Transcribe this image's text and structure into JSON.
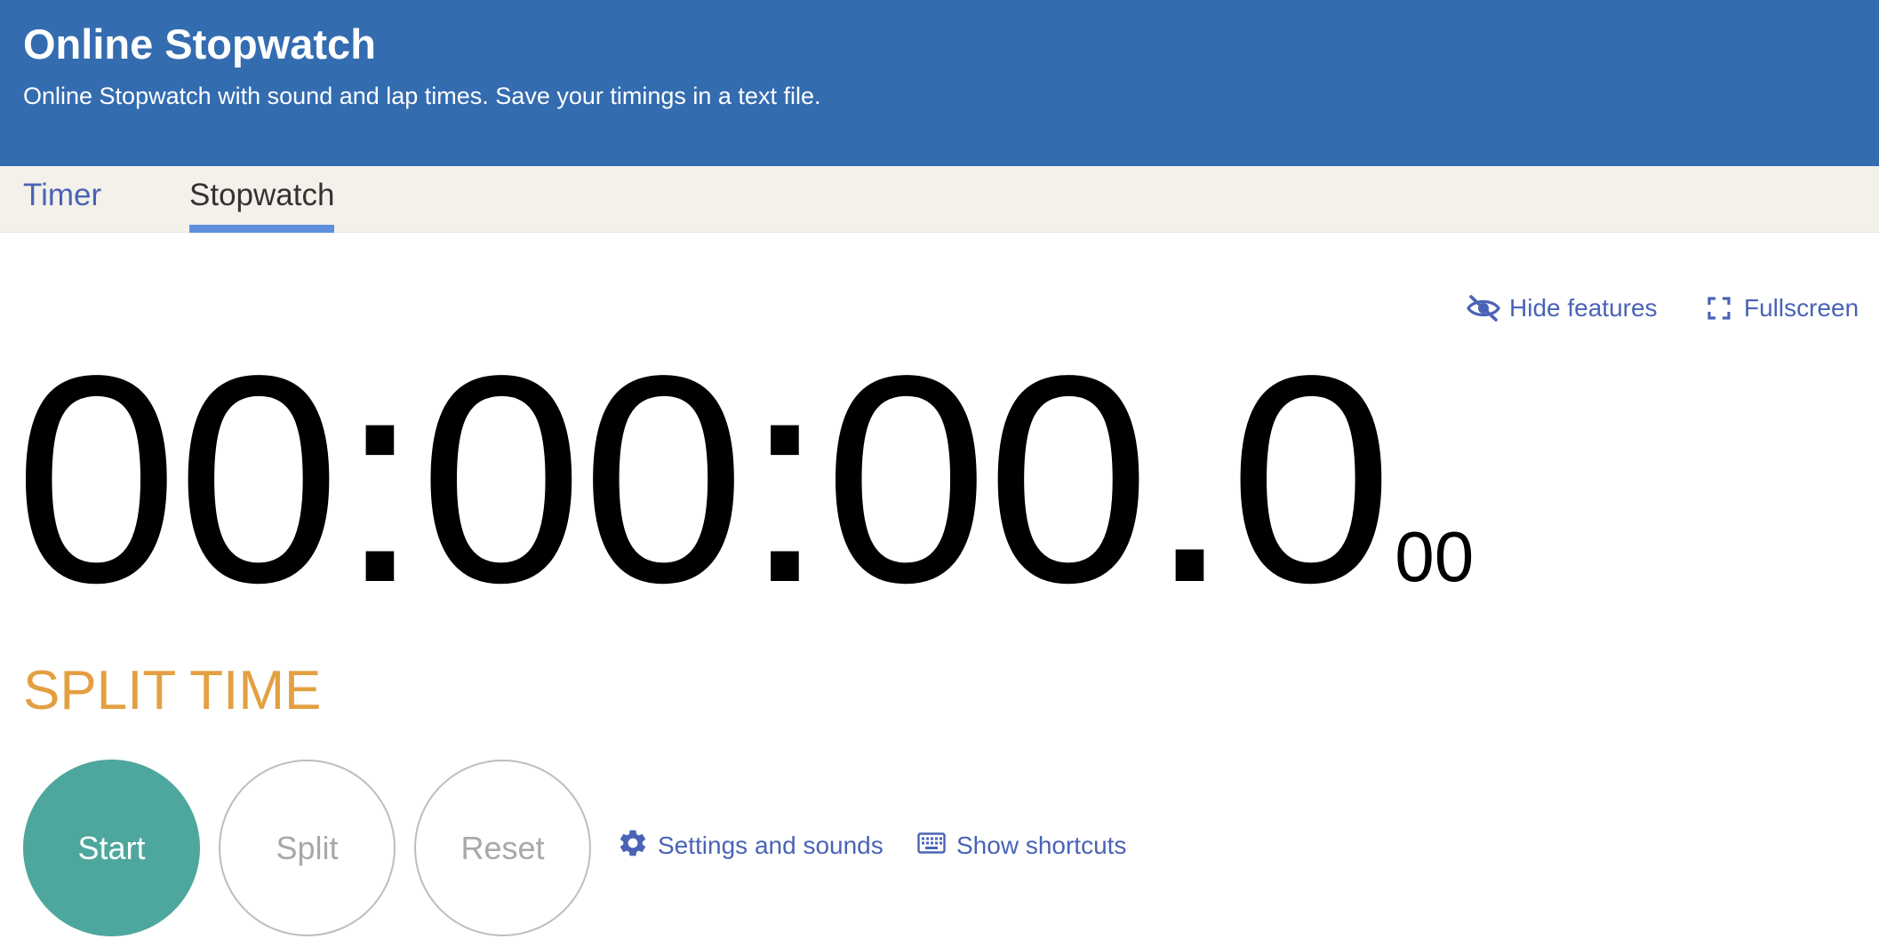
{
  "header": {
    "title": "Online Stopwatch",
    "subtitle": "Online Stopwatch with sound and lap times. Save your timings in a text file."
  },
  "tabs": [
    {
      "label": "Timer",
      "active": false
    },
    {
      "label": "Stopwatch",
      "active": true
    }
  ],
  "features": {
    "hide_label": "Hide features",
    "hide_icon": "eye-off-icon",
    "fullscreen_label": "Fullscreen",
    "fullscreen_icon": "fullscreen-icon"
  },
  "clock": {
    "main": "00:00:00.0",
    "small": "00"
  },
  "split_time_label": "SPLIT TIME",
  "buttons": {
    "start": "Start",
    "split": "Split",
    "reset": "Reset"
  },
  "links": {
    "settings_label": "Settings and sounds",
    "settings_icon": "gear-icon",
    "shortcuts_label": "Show shortcuts",
    "shortcuts_icon": "keyboard-icon"
  },
  "colors": {
    "header_bg": "#346cb0",
    "tab_bar_bg": "#f4f1ea",
    "active_tab_underline": "#5d8fde",
    "link": "#4a63b6",
    "split_time": "#e3a043",
    "start_button": "#4ea79d",
    "disabled_button_text": "#a8a8a8"
  }
}
